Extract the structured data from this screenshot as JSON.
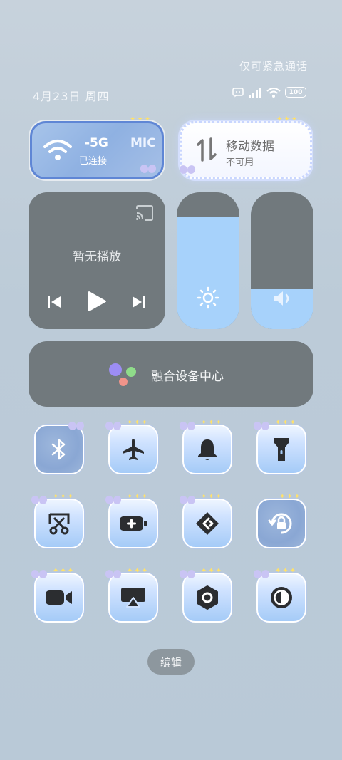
{
  "status": {
    "emergency_text": "仅可紧急通话",
    "date_text": "4月23日 周四",
    "battery": "100"
  },
  "wifi_card": {
    "network": "-5G",
    "network_suffix": "MIC",
    "status": "已连接"
  },
  "data_card": {
    "title": "移动数据",
    "status": "不可用"
  },
  "media": {
    "empty_text": "暂无播放"
  },
  "brightness": {
    "level": 0.82
  },
  "volume": {
    "level": 0.29
  },
  "device_center": {
    "label": "融合设备中心"
  },
  "toggles": [
    {
      "name": "bluetooth",
      "icon": "bluetooth-icon"
    },
    {
      "name": "airplane",
      "icon": "airplane-icon"
    },
    {
      "name": "ring",
      "icon": "bell-icon"
    },
    {
      "name": "flashlight",
      "icon": "flashlight-icon"
    },
    {
      "name": "screenshot",
      "icon": "scissors-icon"
    },
    {
      "name": "battery-saver",
      "icon": "battery-plus-icon"
    },
    {
      "name": "cast",
      "icon": "link-icon"
    },
    {
      "name": "rotation-lock",
      "icon": "rotation-lock-icon"
    },
    {
      "name": "screen-record",
      "icon": "video-icon"
    },
    {
      "name": "screen-share",
      "icon": "airplay-icon"
    },
    {
      "name": "settings",
      "icon": "hexagon-icon"
    },
    {
      "name": "dark-mode",
      "icon": "contrast-icon"
    }
  ],
  "edit_label": "编辑",
  "colors": {
    "tile_blue": "#a5cbf7",
    "panel_gray": "#71797d",
    "slider_fill": "#a7d2fb"
  }
}
